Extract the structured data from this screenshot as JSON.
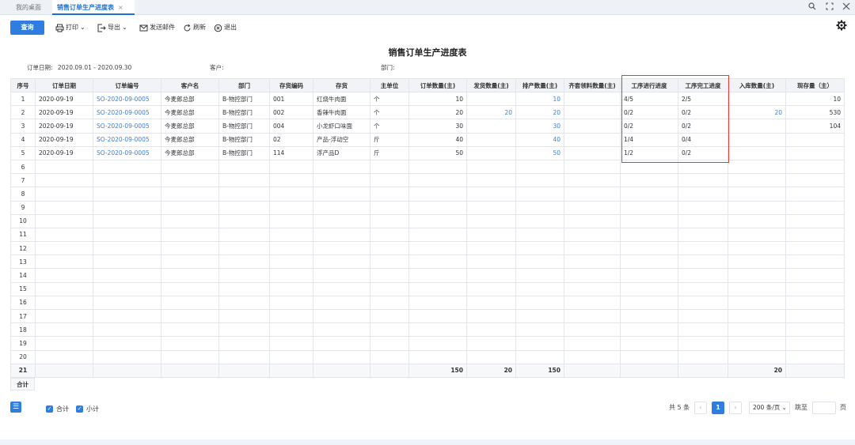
{
  "tabs": {
    "home": "我的桌面",
    "active": "销售订单生产进度表",
    "close": "×"
  },
  "toolbar": {
    "query": "查询",
    "print": "打印",
    "export": "导出",
    "send_mail": "发送邮件",
    "refresh": "刷新",
    "exit": "退出"
  },
  "report": {
    "title": "销售订单生产进度表",
    "date_label": "订单日期:",
    "date_value": "2020.09.01 - 2020.09.30",
    "customer_label": "客户:",
    "dept_label": "部门:"
  },
  "columns": [
    "序号",
    "订单日期",
    "订单编号",
    "客户名",
    "部门",
    "存货编码",
    "存货",
    "主单位",
    "订单数量(主)",
    "发货数量(主)",
    "排产数量(主)",
    "齐套领料数量(主)",
    "工序进行进度",
    "工序完工进度",
    "入库数量(主)",
    "现存量（主）"
  ],
  "rows": [
    [
      "1",
      "2020-09-19",
      "SO-2020-09-0005",
      "今麦郎总部",
      "B-物控部门",
      "001",
      "红烧牛肉面",
      "个",
      "10",
      "",
      "10",
      "",
      "4/5",
      "2/5",
      "",
      "10"
    ],
    [
      "2",
      "2020-09-19",
      "SO-2020-09-0005",
      "今麦郎总部",
      "B-物控部门",
      "002",
      "香辣牛肉面",
      "个",
      "20",
      "20",
      "20",
      "",
      "0/2",
      "0/2",
      "20",
      "530"
    ],
    [
      "3",
      "2020-09-19",
      "SO-2020-09-0005",
      "今麦郎总部",
      "B-物控部门",
      "004",
      "小龙虾口味面",
      "个",
      "30",
      "",
      "30",
      "",
      "0/2",
      "0/2",
      "",
      "104"
    ],
    [
      "4",
      "2020-09-19",
      "SO-2020-09-0005",
      "今麦郎总部",
      "B-物控部门",
      "02",
      "产品-浮动空",
      "斤",
      "40",
      "",
      "40",
      "",
      "1/4",
      "0/4",
      "",
      ""
    ],
    [
      "5",
      "2020-09-19",
      "SO-2020-09-0005",
      "今麦郎总部",
      "B-物控部门",
      "114",
      "浮产品D",
      "斤",
      "50",
      "",
      "50",
      "",
      "1/2",
      "0/2",
      "",
      ""
    ]
  ],
  "empty_rows": [
    "6",
    "7",
    "8",
    "9",
    "10",
    "11",
    "12",
    "13",
    "14",
    "15",
    "16",
    "17",
    "18",
    "19",
    "20"
  ],
  "total_row": {
    "seq": "21",
    "order_qty": "150",
    "ship_qty": "20",
    "plan_qty": "150",
    "in_qty": "20"
  },
  "total_label": "合计",
  "footer": {
    "sum_label": "合计",
    "subtotal_label": "小计",
    "count_text": "共 5 条",
    "page": "1",
    "page_size": "200 条/页",
    "jump_label": "跳至",
    "page_unit": "页"
  },
  "colors": {
    "accent": "#2f7de1",
    "link": "#3d7ed8",
    "highlight_box": "#e53935"
  }
}
